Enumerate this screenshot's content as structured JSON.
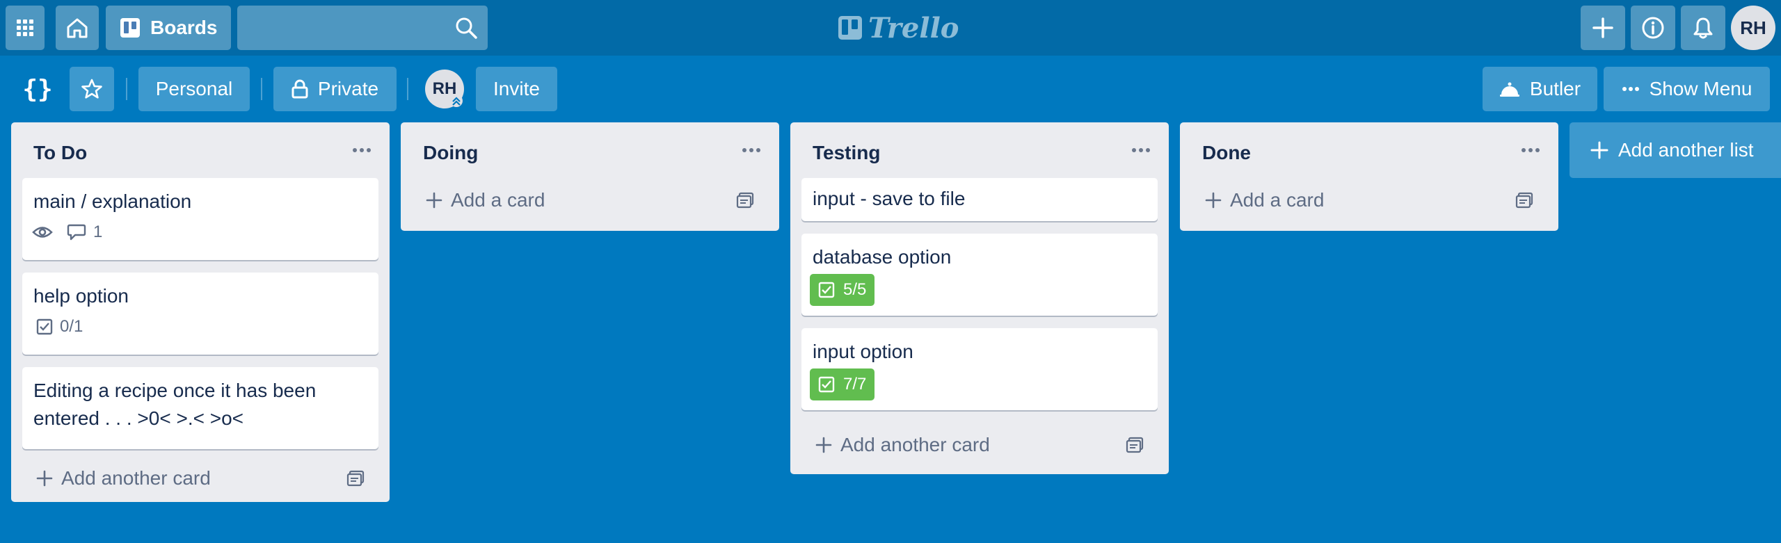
{
  "header": {
    "boards_label": "Boards",
    "search_placeholder": "",
    "logo_text": "Trello",
    "avatar_initials": "RH"
  },
  "board": {
    "title": "{}",
    "team_label": "Personal",
    "visibility_label": "Private",
    "member_initials": "RH",
    "invite_label": "Invite",
    "butler_label": "Butler",
    "show_menu_label": "Show Menu"
  },
  "lists": [
    {
      "title": "To Do",
      "cards": [
        {
          "title": "main / explanation",
          "comments": "1"
        },
        {
          "title": "help option",
          "checklist": "0/1"
        },
        {
          "title": "Editing a recipe once it has been entered . . . >0< >.< >o<"
        }
      ],
      "add_label": "Add another card"
    },
    {
      "title": "Doing",
      "cards": [],
      "add_label": "Add a card"
    },
    {
      "title": "Testing",
      "cards": [
        {
          "title": "input - save to file"
        },
        {
          "title": "database option",
          "checklist": "5/5"
        },
        {
          "title": "input option",
          "checklist": "7/7"
        }
      ],
      "add_label": "Add another card"
    },
    {
      "title": "Done",
      "cards": [],
      "add_label": "Add a card"
    }
  ],
  "add_list_label": "Add another list",
  "colors": {
    "board_bg": "#0079bf",
    "header_bg": "#026aa7",
    "list_bg": "#ebecf0",
    "complete_badge": "#61bd4f"
  }
}
